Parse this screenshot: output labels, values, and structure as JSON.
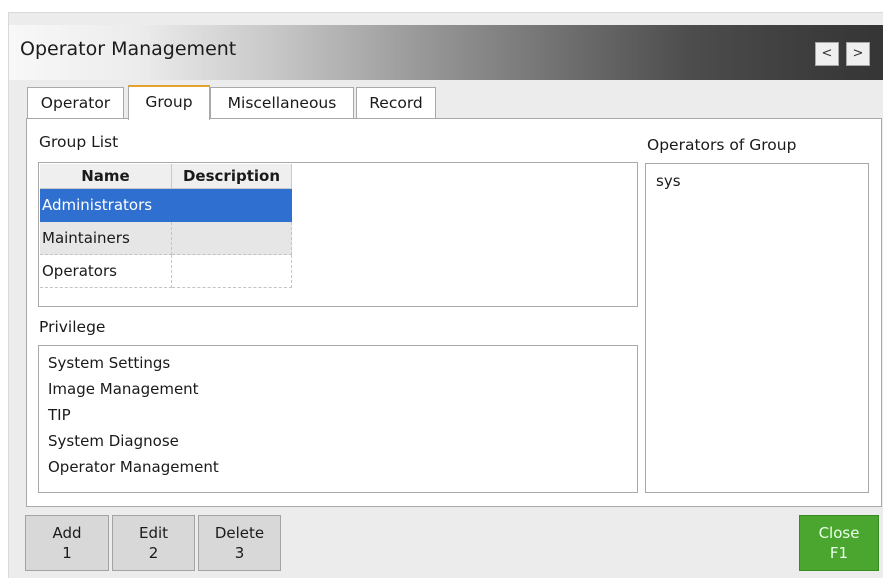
{
  "window": {
    "title": "Operator Management",
    "prev_label": "<",
    "next_label": ">"
  },
  "tabs": [
    {
      "label": "Operator",
      "active": false
    },
    {
      "label": "Group",
      "active": true
    },
    {
      "label": "Miscellaneous",
      "active": false
    },
    {
      "label": "Record",
      "active": false
    }
  ],
  "group_list": {
    "label": "Group List",
    "columns": [
      "Name",
      "Description"
    ],
    "rows": [
      {
        "name": "Administrators",
        "description": "",
        "selected": true
      },
      {
        "name": "Maintainers",
        "description": ""
      },
      {
        "name": "Operators",
        "description": ""
      }
    ]
  },
  "privilege": {
    "label": "Privilege",
    "items": [
      "System Settings",
      "Image Management",
      "TIP",
      "System Diagnose",
      "Operator Management"
    ]
  },
  "operators_of_group": {
    "label": "Operators of Group",
    "items": [
      "sys"
    ]
  },
  "footer": {
    "add": {
      "label": "Add",
      "key": "1"
    },
    "edit": {
      "label": "Edit",
      "key": "2"
    },
    "delete": {
      "label": "Delete",
      "key": "3"
    },
    "close": {
      "label": "Close",
      "key": "F1"
    }
  },
  "colors": {
    "selection": "#2e6fd0",
    "active_tab_accent": "#e3a22a",
    "close_button": "#4aa62e"
  }
}
